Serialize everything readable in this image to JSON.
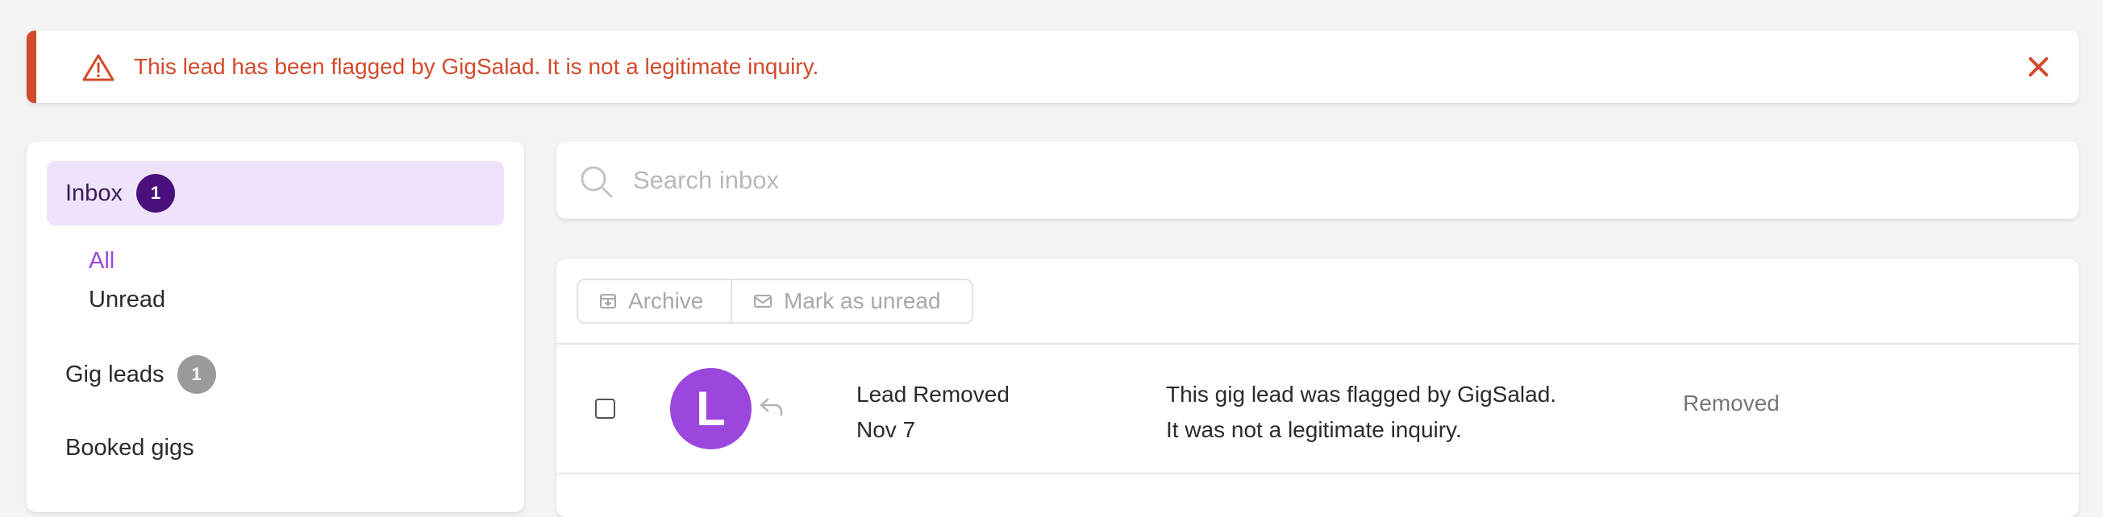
{
  "alert": {
    "message": "This lead has been flagged by GigSalad. It is not a legitimate inquiry.",
    "icon": "warning-triangle-icon",
    "close_icon": "close-icon",
    "color": "#d34a2b"
  },
  "sidebar": {
    "inbox": {
      "label": "Inbox",
      "badge": "1"
    },
    "inbox_filters": [
      {
        "label": "All",
        "active": true
      },
      {
        "label": "Unread",
        "active": false
      }
    ],
    "gig_leads": {
      "label": "Gig leads",
      "badge": "1"
    },
    "booked_gigs": {
      "label": "Booked gigs"
    }
  },
  "search": {
    "placeholder": "Search inbox",
    "value": ""
  },
  "toolbar": {
    "archive_label": "Archive",
    "mark_unread_label": "Mark as unread"
  },
  "messages": [
    {
      "avatar_letter": "L",
      "avatar_color": "#9b47de",
      "title": "Lead Removed",
      "date": "Nov 7",
      "body_line1": "This gig lead was flagged by GigSalad.",
      "body_line2": "It was not a legitimate inquiry.",
      "status": "Removed",
      "checked": false
    }
  ],
  "colors": {
    "accent_purple": "#9a4ae0",
    "inbox_highlight": "#efe2fb",
    "badge_dark_purple": "#4b0f7d",
    "badge_gray": "#9a9a9a"
  }
}
